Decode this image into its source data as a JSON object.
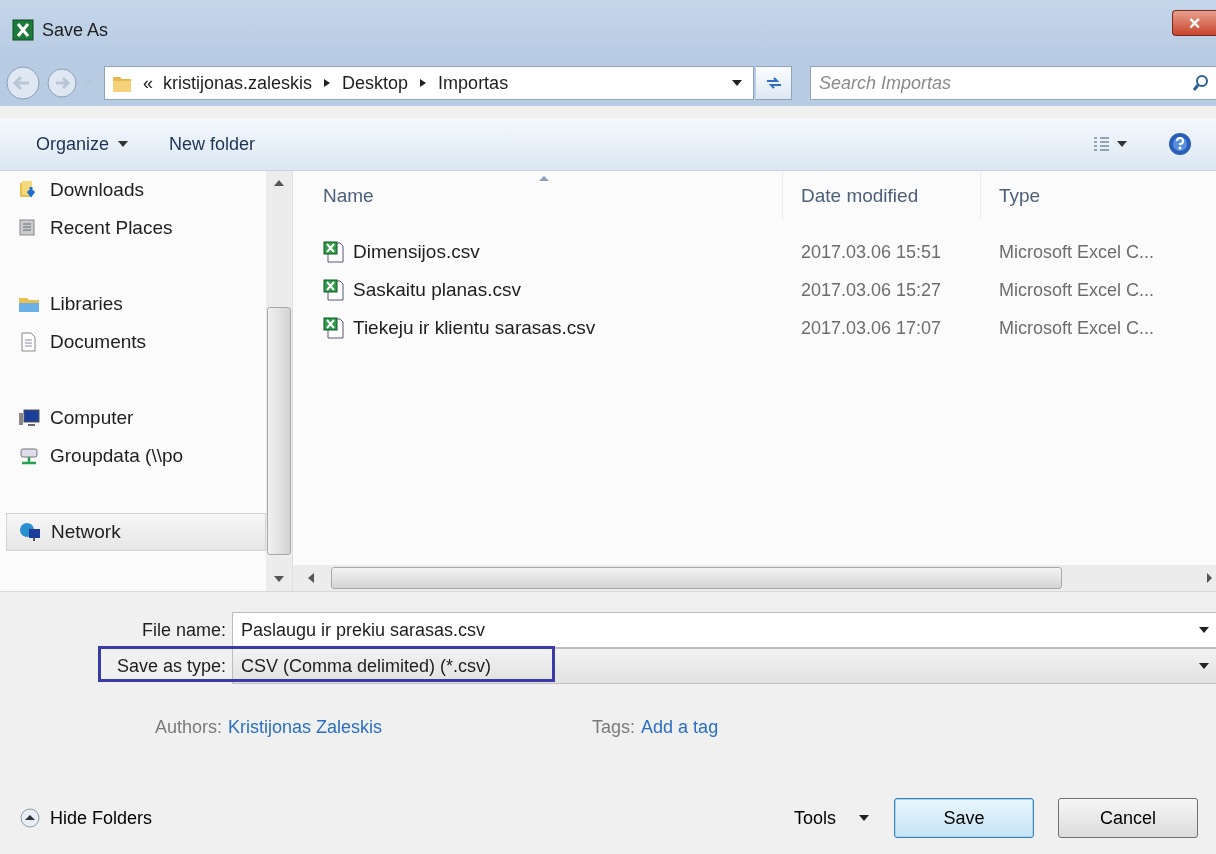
{
  "window": {
    "title": "Save As",
    "close": "×"
  },
  "address": {
    "overflow": "«",
    "crumbs": [
      "kristijonas.zaleskis",
      "Desktop",
      "Importas"
    ],
    "search_placeholder": "Search Importas"
  },
  "toolbar": {
    "organize": "Organize",
    "new_folder": "New folder"
  },
  "nav": [
    {
      "children": [
        {
          "label": "Downloads",
          "kind": "downloads",
          "selected": false
        },
        {
          "label": "Recent Places",
          "kind": "recent",
          "selected": false
        }
      ]
    },
    {
      "label": "Libraries",
      "kind": "library",
      "selected": false,
      "children": [
        {
          "label": "Documents",
          "kind": "documents",
          "selected": false
        }
      ]
    },
    {
      "label": "Computer",
      "kind": "computer",
      "selected": false,
      "children": [
        {
          "label": "Groupdata (\\\\po",
          "kind": "drive",
          "selected": false
        }
      ]
    },
    {
      "label": "Network",
      "kind": "network",
      "selected": true
    }
  ],
  "table": {
    "columns": [
      "Name",
      "Date modified",
      "Type"
    ],
    "rows": [
      {
        "name": "Dimensijos.csv",
        "date": "2017.03.06 15:51",
        "type": "Microsoft Excel C..."
      },
      {
        "name": "Saskaitu planas.csv",
        "date": "2017.03.06 15:27",
        "type": "Microsoft Excel C..."
      },
      {
        "name": "Tiekeju ir klientu sarasas.csv",
        "date": "2017.03.06 17:07",
        "type": "Microsoft Excel C..."
      }
    ]
  },
  "form": {
    "file_name_label": "File name:",
    "file_name": "Paslaugu ir prekiu sarasas.csv",
    "type_label": "Save as type:",
    "type_value": "CSV (Comma delimited) (*.csv)",
    "type_highlighted": true,
    "authors_label": "Authors:",
    "authors": "Kristijonas Zaleskis",
    "tags_label": "Tags:",
    "tags": "Add a tag"
  },
  "buttons": {
    "hide_folders": "Hide Folders",
    "tools": "Tools",
    "save": "Save",
    "cancel": "Cancel"
  }
}
